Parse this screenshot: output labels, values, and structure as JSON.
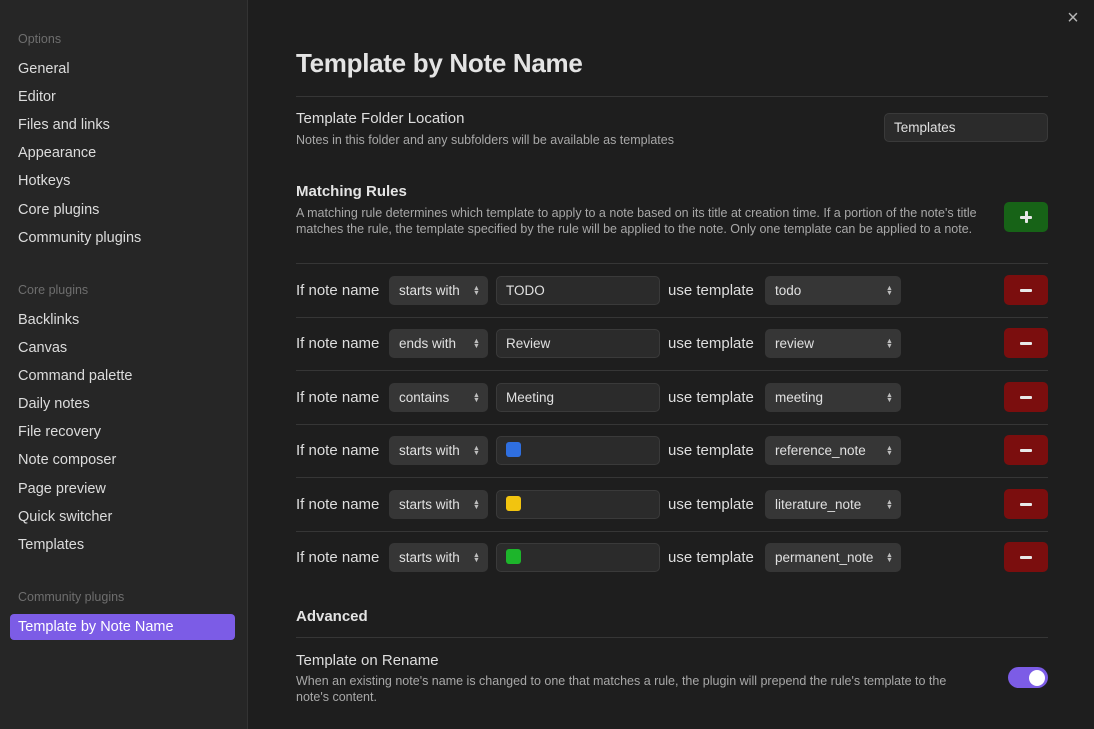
{
  "sidebar": {
    "options_header": "Options",
    "options": [
      "General",
      "Editor",
      "Files and links",
      "Appearance",
      "Hotkeys",
      "Core plugins",
      "Community plugins"
    ],
    "core_header": "Core plugins",
    "core": [
      "Backlinks",
      "Canvas",
      "Command palette",
      "Daily notes",
      "File recovery",
      "Note composer",
      "Page preview",
      "Quick switcher",
      "Templates"
    ],
    "community_header": "Community plugins",
    "community": [
      "Template by Note Name"
    ]
  },
  "page": {
    "title": "Template by Note Name",
    "folder": {
      "name": "Template Folder Location",
      "desc": "Notes in this folder and any subfolders will be available as templates",
      "value": "Templates"
    },
    "rules": {
      "title": "Matching Rules",
      "desc": "A matching rule determines which template to apply to a note based on its title at creation time. If a portion of the note's title matches the rule, the template specified by the rule will be applied to the note. Only one template can be applied to a note.",
      "if_label": "If note name",
      "use_label": "use template",
      "items": [
        {
          "match": "starts with",
          "value": "TODO",
          "template": "todo"
        },
        {
          "match": "ends with",
          "value": "Review",
          "template": "review"
        },
        {
          "match": "contains",
          "value": "Meeting",
          "template": "meeting"
        },
        {
          "match": "starts with",
          "value": "",
          "swatch": "#2f6fe0",
          "template": "reference_note"
        },
        {
          "match": "starts with",
          "value": "",
          "swatch": "#f2c40f",
          "template": "literature_note"
        },
        {
          "match": "starts with",
          "value": "",
          "swatch": "#1db52b",
          "template": "permanent_note"
        }
      ]
    },
    "advanced": {
      "title": "Advanced",
      "rename_name": "Template on Rename",
      "rename_desc": "When an existing note's name is changed to one that matches a rule, the plugin will prepend the rule's template to the note's content.",
      "rename_enabled": true
    }
  },
  "icons": {
    "close": "×",
    "chevron": "⌃⌄"
  },
  "colors": {
    "accent": "#7c5ce6",
    "add": "#176317",
    "delete": "#7b0e0e"
  }
}
